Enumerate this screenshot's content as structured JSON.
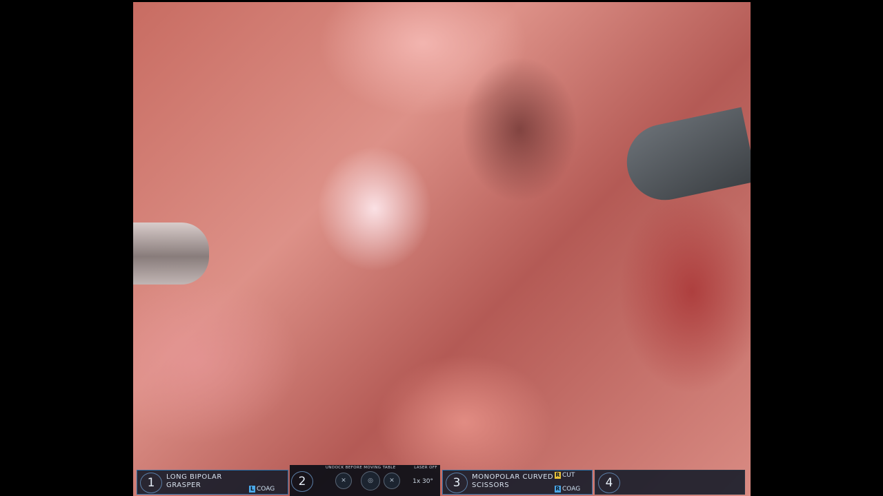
{
  "hud": {
    "arm1": {
      "number": "1",
      "label_line1": "LONG BIPOLAR",
      "label_line2": "GRASPER",
      "coag_key": "L",
      "coag_label": "COAG"
    },
    "arm2": {
      "number": "2",
      "warning": "UNDOCK BEFORE MOVING TABLE",
      "laser": "LASER OFF",
      "zoom": "1x  30°"
    },
    "arm3": {
      "number": "3",
      "label_line1": "MONOPOLAR CURVED",
      "label_line2": "SCISSORS",
      "cut_key": "R",
      "cut_label": "CUT",
      "coag_key": "R",
      "coag_label": "COAG"
    },
    "arm4": {
      "number": "4"
    }
  },
  "colors": {
    "hud_border": "#2c6fa6",
    "cut_key": "#e8c23a",
    "coag_key": "#4aa8e8"
  }
}
